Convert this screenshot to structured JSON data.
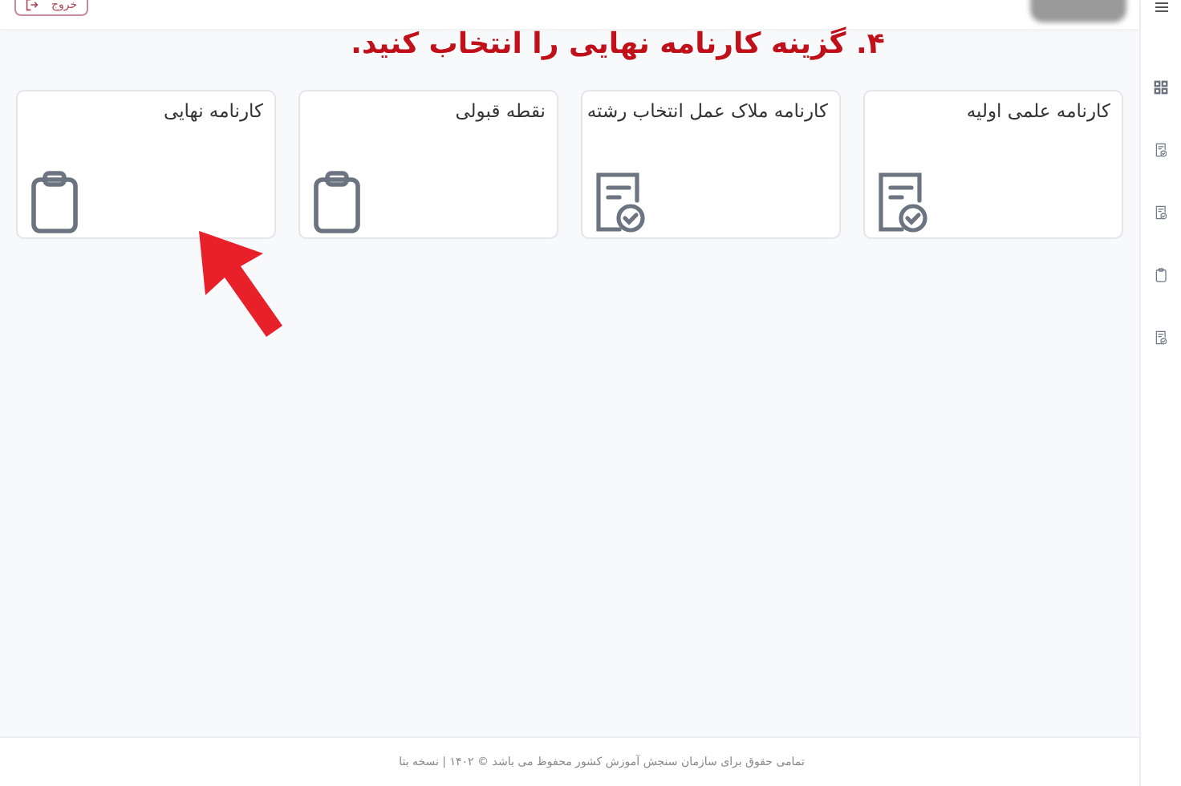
{
  "top_bar": {
    "logout_button": {
      "label": "خروج"
    }
  },
  "instruction": "۴. گزینه کارنامه نهایی را انتخاب کنید.",
  "cards": [
    {
      "title": "کارنامه علمی اولیه",
      "kind": "report"
    },
    {
      "title": "کارنامه ملاک عمل انتخاب رشته",
      "kind": "report"
    },
    {
      "title": "نقطه قبولی",
      "kind": "clipboard"
    },
    {
      "title": "کارنامه نهایی",
      "kind": "clipboard"
    }
  ],
  "sidebar": {
    "items": [
      {
        "kind": "grid"
      },
      {
        "kind": "report"
      },
      {
        "kind": "report"
      },
      {
        "kind": "clipboard"
      },
      {
        "kind": "report"
      }
    ]
  },
  "footer": "تمامی حقوق برای سازمان سنجش آموزش کشور محفوظ می باشد © ۱۴۰۲ | نسخه بتا"
}
